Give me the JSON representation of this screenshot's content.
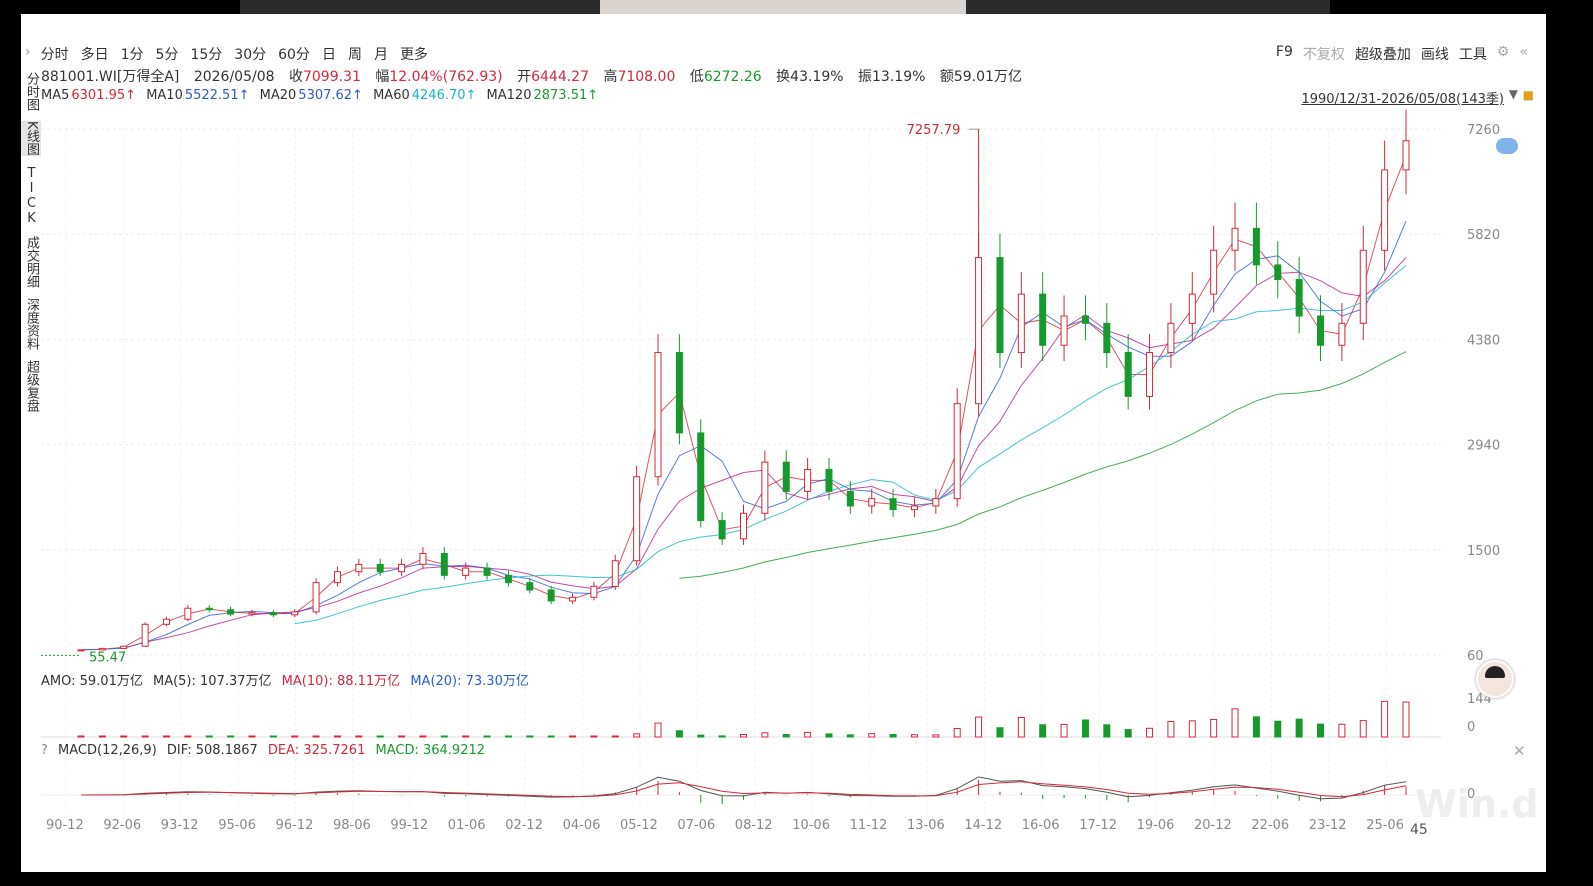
{
  "toolbar": {
    "periods": [
      "分时",
      "多日",
      "1分",
      "5分",
      "15分",
      "30分",
      "60分",
      "日",
      "周",
      "月",
      "更多"
    ],
    "tools": [
      "F9",
      "不复权",
      "超级叠加",
      "画线",
      "工具"
    ]
  },
  "sidebar": [
    "分时图",
    "K线图",
    "TICK",
    "成交明细",
    "深度资料",
    "超级复盘"
  ],
  "info": {
    "code": "881001.WI[万得全A]",
    "date": "2026/05/08",
    "close_label": "收",
    "close": "7099.31",
    "chg_label": "幅",
    "chg": "12.04%(762.93)",
    "open_label": "开",
    "open": "6444.27",
    "high_label": "高",
    "high": "7108.00",
    "low_label": "低",
    "low": "6272.26",
    "turnover_label": "换",
    "turnover": "43.19%",
    "amp_label": "振",
    "amp": "13.19%",
    "amount_label": "额",
    "amount": "59.01万亿"
  },
  "ma_line": {
    "ma5_label": "MA5",
    "ma5": "6301.95↑",
    "ma10_label": "MA10",
    "ma10": "5522.51↑",
    "ma20_label": "MA20",
    "ma20": "5307.62↑",
    "ma60_label": "MA60",
    "ma60": "4246.70↑",
    "ma120_label": "MA120",
    "ma120": "2873.51↑"
  },
  "range": "1990/12/31-2026/05/08(143季)",
  "amo": {
    "amo": "AMO: 59.01万亿",
    "ma5": "MA(5): 107.37万亿",
    "ma10": "MA(10): 88.11万亿",
    "ma20": "MA(20): 73.30万亿",
    "ytick_top": "144",
    "ytick_zero": "0"
  },
  "macd": {
    "q": "?",
    "name": "MACD(12,26,9)",
    "dif": "DIF: 508.1867",
    "dea": "DEA: 325.7261",
    "macd": "MACD: 364.9212",
    "ytick_zero": "0"
  },
  "extra_label": "45",
  "watermark": "Win.d",
  "colors": {
    "up": "#d3293a",
    "down": "#169a2c",
    "ma5": "#d3293a",
    "ma10": "#2e5bcc",
    "ma20": "#b02090",
    "ma60": "#17b5c9",
    "ma120": "#1a9a2a"
  },
  "chart_data": {
    "type": "candlestick",
    "y_ticks": [
      60,
      1500,
      2940,
      4380,
      5820,
      7260
    ],
    "ylim": [
      60,
      7260
    ],
    "x_ticks": [
      "90-12",
      "92-06",
      "93-12",
      "95-06",
      "96-12",
      "98-06",
      "99-12",
      "01-06",
      "02-12",
      "04-06",
      "05-12",
      "07-06",
      "08-12",
      "10-06",
      "11-12",
      "13-06",
      "14-12",
      "16-06",
      "17-12",
      "19-06",
      "20-12",
      "22-06",
      "23-12",
      "25-06"
    ],
    "annotations": [
      {
        "text": "7257.79",
        "value": 7257.79
      },
      {
        "text": "55.47",
        "value": 55.47
      }
    ],
    "closes_approx": [
      130,
      150,
      180,
      480,
      550,
      700,
      680,
      620,
      640,
      610,
      650,
      1050,
      1200,
      1300,
      1200,
      1300,
      1450,
      1150,
      1250,
      1150,
      1050,
      950,
      800,
      850,
      1000,
      1350,
      2500,
      4200,
      3100,
      1900,
      1650,
      2000,
      2700,
      2300,
      2600,
      2300,
      2100,
      2200,
      2050,
      2100,
      2200,
      3500,
      5500,
      4200,
      5000,
      4300,
      4700,
      4600,
      4200,
      3600,
      4200,
      4600,
      5000,
      5600,
      5900,
      5400,
      5200,
      4700,
      4300,
      4600,
      5600,
      6700,
      7099
    ]
  }
}
